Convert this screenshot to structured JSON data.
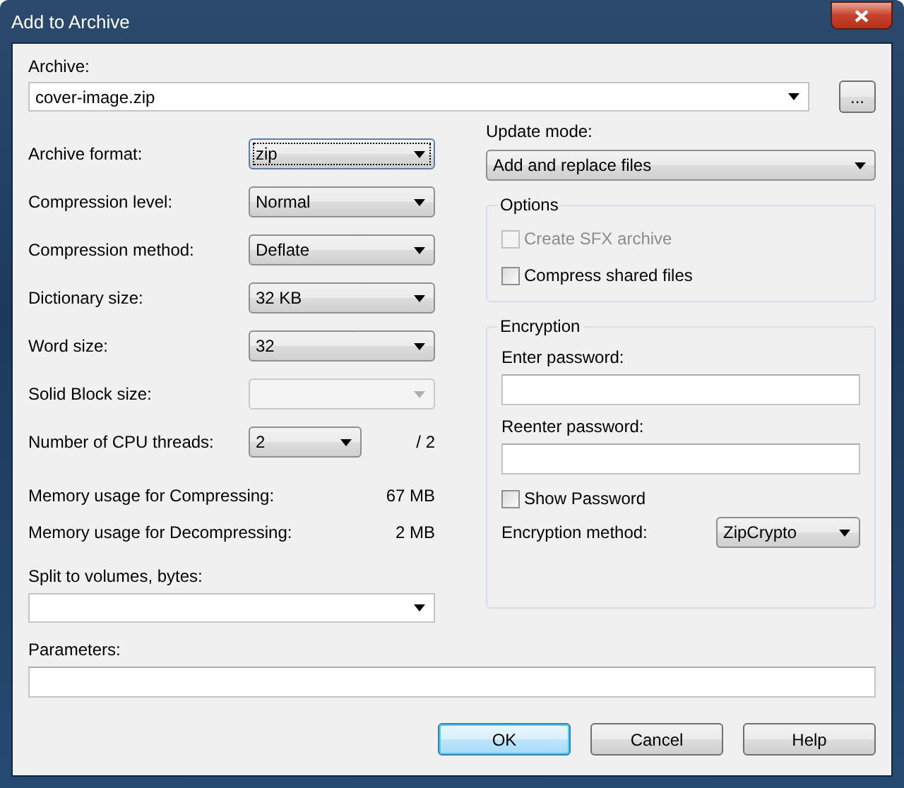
{
  "window": {
    "title": "Add to Archive"
  },
  "archive": {
    "label": "Archive:",
    "value": "cover-image.zip",
    "browse": "..."
  },
  "settings": [
    {
      "label": "Archive format:",
      "value": "zip",
      "focused": true,
      "disabled": false
    },
    {
      "label": "Compression level:",
      "value": "Normal",
      "focused": false,
      "disabled": false
    },
    {
      "label": "Compression method:",
      "value": "Deflate",
      "focused": false,
      "disabled": false
    },
    {
      "label": "Dictionary size:",
      "value": "32 KB",
      "focused": false,
      "disabled": false
    },
    {
      "label": "Word size:",
      "value": "32",
      "focused": false,
      "disabled": false
    },
    {
      "label": "Solid Block size:",
      "disabled": true
    }
  ],
  "threads": {
    "label": "Number of CPU threads:",
    "value": "2",
    "max": "/ 2"
  },
  "memory": [
    {
      "label": "Memory usage for Compressing:",
      "value": "67 MB"
    },
    {
      "label": "Memory usage for Decompressing:",
      "value": "2 MB"
    }
  ],
  "split": {
    "label": "Split to volumes, bytes:"
  },
  "update": {
    "label": "Update mode:",
    "value": "Add and replace files"
  },
  "options": {
    "title": "Options",
    "items": [
      {
        "label": "Create SFX archive",
        "checked": false,
        "disabled": true
      },
      {
        "label": "Compress shared files",
        "checked": false,
        "disabled": false
      }
    ]
  },
  "encryption": {
    "title": "Encryption",
    "fields": [
      {
        "label": "Enter password:"
      },
      {
        "label": "Reenter password:"
      }
    ],
    "show_password": {
      "label": "Show Password",
      "checked": false
    },
    "method": {
      "label": "Encryption method:",
      "value": "ZipCrypto"
    }
  },
  "parameters": {
    "label": "Parameters:"
  },
  "buttons": [
    {
      "label": "OK",
      "default": true
    },
    {
      "label": "Cancel",
      "default": false
    },
    {
      "label": "Help",
      "default": false
    }
  ]
}
